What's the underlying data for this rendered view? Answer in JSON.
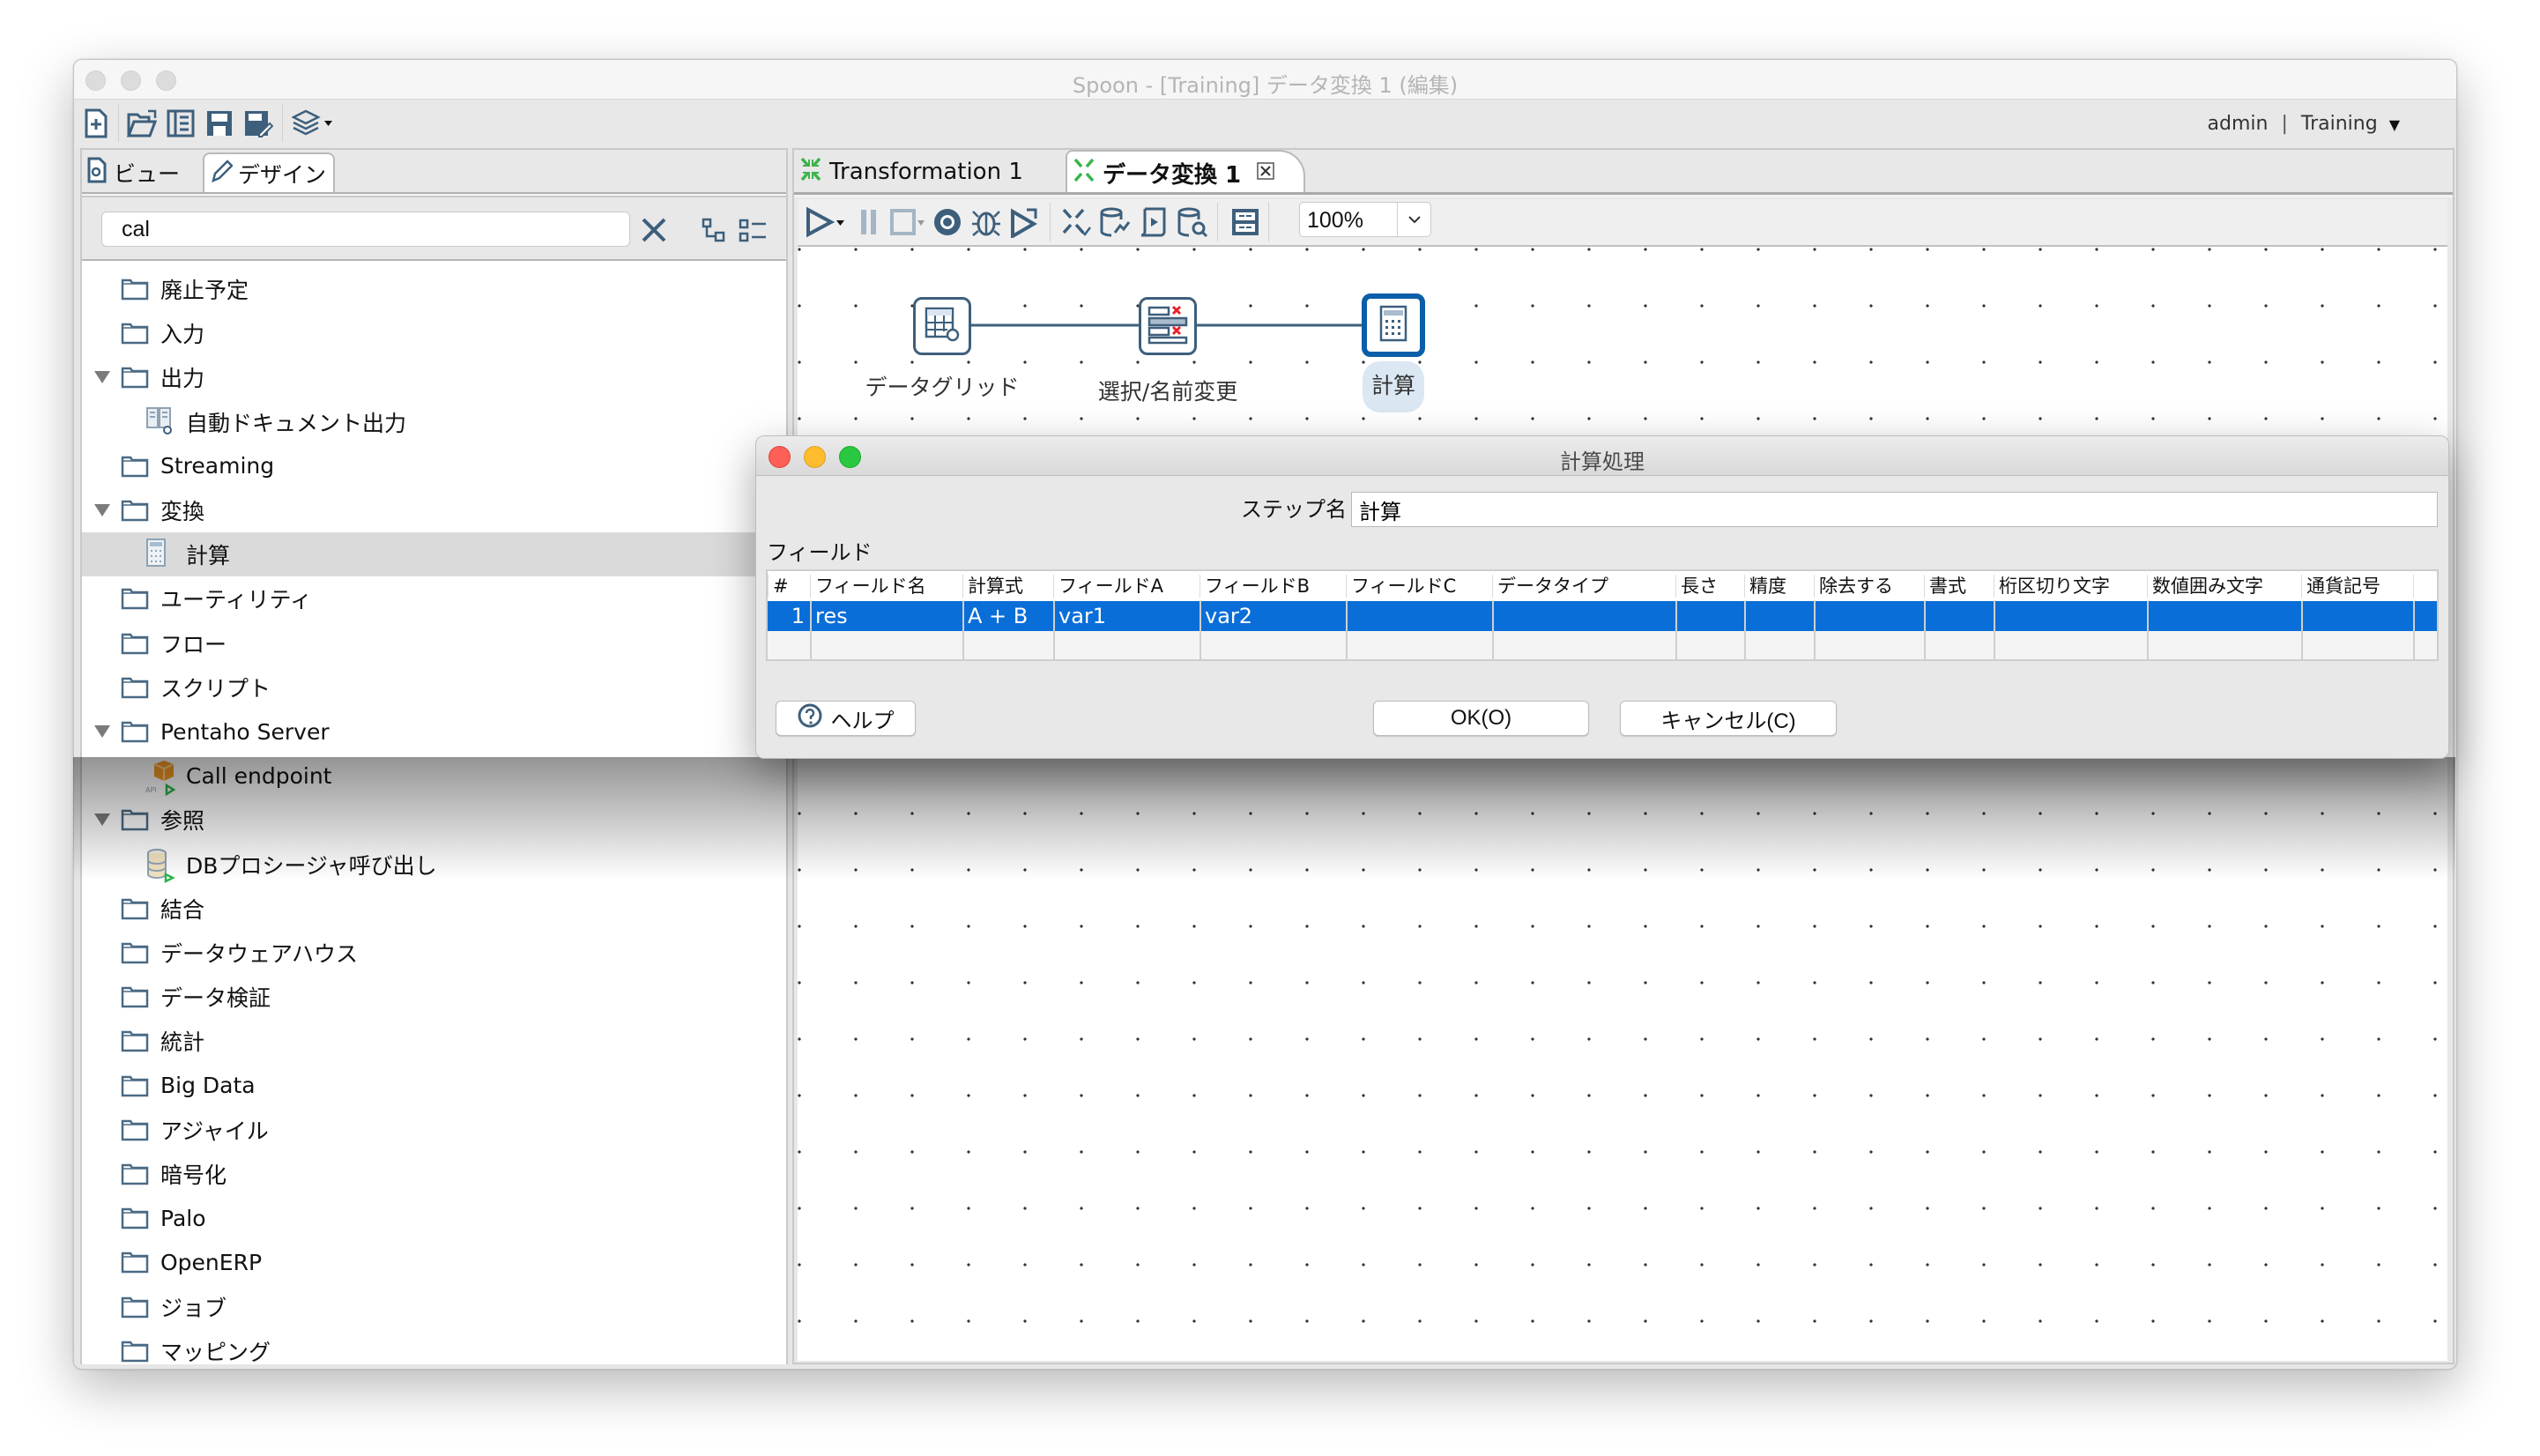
{
  "window": {
    "title": "Spoon - [Training] データ変換 1 (編集)"
  },
  "main_toolbar": {
    "icons": [
      "new-file-icon",
      "open-file-icon",
      "explore-repository-icon",
      "save-icon",
      "save-as-icon",
      "perspective-layers-icon"
    ],
    "user": "admin",
    "separator": "|",
    "repository": "Training",
    "repository_dropdown": "▾"
  },
  "left_panel": {
    "tabs": [
      {
        "label": "ビュー",
        "icon": "view-icon",
        "active": false
      },
      {
        "label": "デザイン",
        "icon": "pencil-icon",
        "active": true
      }
    ],
    "search": {
      "value": "cal",
      "placeholder": ""
    },
    "clear_search": "✕",
    "tree": [
      {
        "label": "廃止予定",
        "type": "folder",
        "expanded": false,
        "level": 0
      },
      {
        "label": "入力",
        "type": "folder",
        "expanded": false,
        "level": 0
      },
      {
        "label": "出力",
        "type": "folder",
        "expanded": true,
        "level": 0
      },
      {
        "label": "自動ドキュメント出力",
        "type": "step",
        "icon": "auto-documentation-icon",
        "level": 1
      },
      {
        "label": "Streaming",
        "type": "folder",
        "expanded": false,
        "level": 0
      },
      {
        "label": "変換",
        "type": "folder",
        "expanded": true,
        "level": 0
      },
      {
        "label": "計算",
        "type": "step",
        "icon": "calculator-icon",
        "level": 1,
        "selected": true
      },
      {
        "label": "ユーティリティ",
        "type": "folder",
        "expanded": false,
        "level": 0
      },
      {
        "label": "フロー",
        "type": "folder",
        "expanded": false,
        "level": 0
      },
      {
        "label": "スクリプト",
        "type": "folder",
        "expanded": false,
        "level": 0
      },
      {
        "label": "Pentaho Server",
        "type": "folder",
        "expanded": true,
        "level": 0
      },
      {
        "label": "Call endpoint",
        "type": "step",
        "icon": "api-endpoint-icon",
        "level": 1
      },
      {
        "label": "参照",
        "type": "folder",
        "expanded": true,
        "level": 0
      },
      {
        "label": "DBプロシージャ呼び出し",
        "type": "step",
        "icon": "db-procedure-icon",
        "level": 1
      },
      {
        "label": "結合",
        "type": "folder",
        "expanded": false,
        "level": 0
      },
      {
        "label": "データウェアハウス",
        "type": "folder",
        "expanded": false,
        "level": 0
      },
      {
        "label": "データ検証",
        "type": "folder",
        "expanded": false,
        "level": 0
      },
      {
        "label": "統計",
        "type": "folder",
        "expanded": false,
        "level": 0
      },
      {
        "label": "Big Data",
        "type": "folder",
        "expanded": false,
        "level": 0
      },
      {
        "label": "アジャイル",
        "type": "folder",
        "expanded": false,
        "level": 0
      },
      {
        "label": "暗号化",
        "type": "folder",
        "expanded": false,
        "level": 0
      },
      {
        "label": "Palo",
        "type": "folder",
        "expanded": false,
        "level": 0
      },
      {
        "label": "OpenERP",
        "type": "folder",
        "expanded": false,
        "level": 0
      },
      {
        "label": "ジョブ",
        "type": "folder",
        "expanded": false,
        "level": 0
      },
      {
        "label": "マッピング",
        "type": "folder",
        "expanded": false,
        "level": 0
      }
    ]
  },
  "editor": {
    "tabs": [
      {
        "label": "Transformation 1",
        "active": false
      },
      {
        "label": "データ変換 1",
        "active": true,
        "close": "☒"
      }
    ],
    "toolbar": {
      "icons": [
        "run-icon",
        "pause-icon",
        "stop-icon",
        "preview-icon",
        "debug-icon",
        "replay-icon",
        "verify-icon",
        "impact-icon",
        "sql-icon",
        "explore-db-icon",
        "show-results-icon"
      ],
      "zoom": "100%"
    },
    "nodes": [
      {
        "label": "データグリッド",
        "icon": "data-grid-icon",
        "selected": false
      },
      {
        "label": "選択/名前変更",
        "icon": "select-values-icon",
        "selected": false
      },
      {
        "label": "計算",
        "icon": "calculator-icon",
        "selected": true
      }
    ]
  },
  "dialog": {
    "title": "計算処理",
    "step_name_label": "ステップ名",
    "step_name_value": "計算",
    "fields_label": "フィールド",
    "columns": [
      "#",
      "フィールド名",
      "計算式",
      "フィールドA",
      "フィールドB",
      "フィールドC",
      "データタイプ",
      "長さ",
      "精度",
      "除去する",
      "書式",
      "桁区切り文字",
      "数値囲み文字",
      "通貨記号",
      ""
    ],
    "rows": [
      [
        "1",
        "res",
        "A + B",
        "var1",
        "var2",
        "",
        "",
        "",
        "",
        "",
        "",
        "",
        "",
        "",
        ""
      ],
      [
        "",
        "",
        "",
        "",
        "",
        "",
        "",
        "",
        "",
        "",
        "",
        "",
        "",
        "",
        ""
      ]
    ],
    "buttons": {
      "help": "ヘルプ",
      "ok": "OK(O)",
      "cancel": "キャンセル(C)"
    },
    "colors": {
      "selection": "#0a6ed8",
      "close": "#fe5f57",
      "minimize": "#febc2e",
      "maximize": "#28c840"
    }
  }
}
